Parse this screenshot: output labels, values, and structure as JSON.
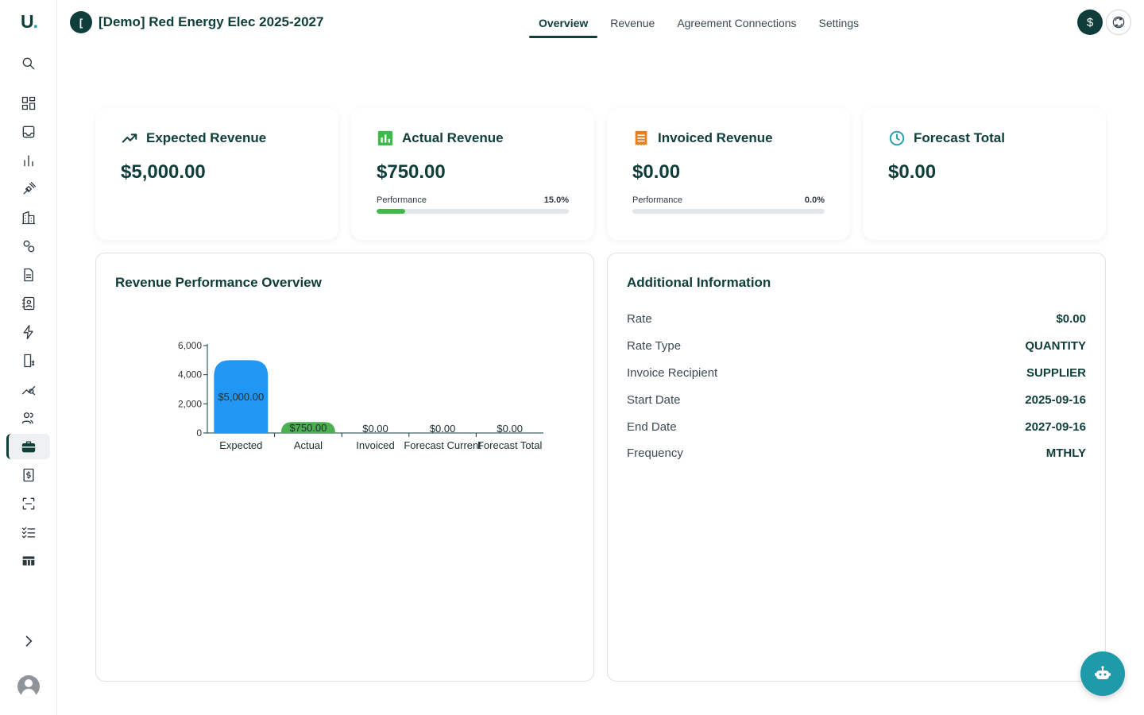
{
  "app": {
    "logo_text": "U",
    "logo_dot": "."
  },
  "header": {
    "badge": "[",
    "title": "[Demo] Red Energy Elec 2025-2027",
    "tabs": [
      {
        "label": "Overview",
        "active": true
      },
      {
        "label": "Revenue",
        "active": false
      },
      {
        "label": "Agreement Connections",
        "active": false
      },
      {
        "label": "Settings",
        "active": false
      }
    ],
    "dollar_icon": "$",
    "sync_icon": "sync-icon"
  },
  "sidebar": {
    "items": [
      {
        "icon": "search-icon"
      },
      {
        "icon": "dashboard-icon"
      },
      {
        "icon": "inbox-icon"
      },
      {
        "icon": "bar-chart-icon"
      },
      {
        "icon": "plug-icon"
      },
      {
        "icon": "building-icon"
      },
      {
        "icon": "map-pin-icon"
      },
      {
        "icon": "document-icon"
      },
      {
        "icon": "contact-book-icon"
      },
      {
        "icon": "lightning-icon"
      },
      {
        "icon": "billing-icon"
      },
      {
        "icon": "analytics-icon"
      },
      {
        "icon": "users-icon"
      },
      {
        "icon": "briefcase-icon",
        "active": true
      },
      {
        "icon": "receipt-icon"
      },
      {
        "icon": "scan-icon"
      },
      {
        "icon": "checklist-icon"
      },
      {
        "icon": "table-icon"
      }
    ]
  },
  "kpis": [
    {
      "label": "Expected Revenue",
      "value": "$5,000.00",
      "icon": "trending-up-icon",
      "icon_color": "#0f3d3a"
    },
    {
      "label": "Actual Revenue",
      "value": "$750.00",
      "icon": "bar-chart-square-icon",
      "icon_color": "#3eb94a",
      "perf_label": "Performance",
      "perf_pct": "15.0%",
      "perf_fraction": 0.15
    },
    {
      "label": "Invoiced Revenue",
      "value": "$0.00",
      "icon": "receipt-icon",
      "icon_color": "#e67e22",
      "perf_label": "Performance",
      "perf_pct": "0.0%",
      "perf_fraction": 0.0
    },
    {
      "label": "Forecast Total",
      "value": "$0.00",
      "icon": "clock-icon",
      "icon_color": "#1e9aa8"
    }
  ],
  "overview_panel": {
    "title": "Revenue Performance Overview"
  },
  "chart_data": {
    "type": "bar",
    "categories": [
      "Expected",
      "Actual",
      "Invoiced",
      "Forecast Current",
      "Forecast Total"
    ],
    "values": [
      5000,
      750,
      0,
      0,
      0
    ],
    "data_labels": [
      "$5,000.00",
      "$750.00",
      "$0.00",
      "$0.00",
      "$0.00"
    ],
    "colors": [
      "#2196f3",
      "#4caf50",
      "#e67e22",
      "#1e9aa8",
      "#0f3d3a"
    ],
    "yticks": [
      0,
      2000,
      4000,
      6000
    ],
    "ytick_labels": [
      "0",
      "2,000",
      "4,000",
      "6,000"
    ],
    "ylim": [
      0,
      6000
    ],
    "grid": false,
    "legend": "none"
  },
  "info_panel": {
    "title": "Additional Information",
    "rows": [
      {
        "label": "Rate",
        "value": "$0.00"
      },
      {
        "label": "Rate Type",
        "value": "QUANTITY"
      },
      {
        "label": "Invoice Recipient",
        "value": "SUPPLIER"
      },
      {
        "label": "Start Date",
        "value": "2025-09-16"
      },
      {
        "label": "End Date",
        "value": "2027-09-16"
      },
      {
        "label": "Frequency",
        "value": "MTHLY"
      }
    ]
  },
  "assistant_button": {
    "icon": "robot-icon"
  }
}
